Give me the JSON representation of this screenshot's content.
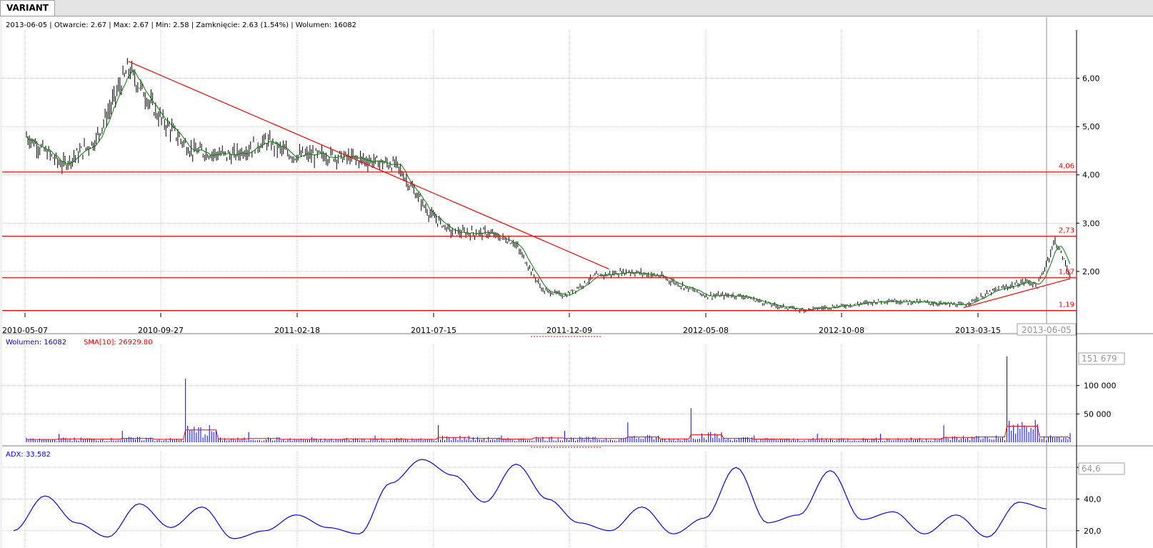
{
  "tab": {
    "label": "VARIANT"
  },
  "info_line": "2013-06-05 | Otwarcie: 2.67 | Max: 2.67 | Min: 2.58 | Zamknięcie: 2.63 (1.54%)  | Wolumen: 16082",
  "volume_info": {
    "volume": "Wolumen: 16082",
    "sma": "SMA[10]: 26929.80",
    "peak": "151 679"
  },
  "adx_info": {
    "label": "ADX: 33.582",
    "peak": "64,6"
  },
  "colors": {
    "price_bars": "#000000",
    "ma_line": "#008000",
    "trend_lines": "#ff0000",
    "volume_bars": "#0000ff",
    "volume_sma": "#ff0000",
    "adx_line": "#0000ff",
    "grid": "#c8c8c8"
  },
  "chart_data": [
    {
      "type": "ohlc",
      "title": "",
      "x_tick_labels": [
        "2010-05-07",
        "2010-09-27",
        "2011-02-18",
        "2011-07-15",
        "2011-12-09",
        "2012-05-08",
        "2012-10-08",
        "2013-03-15",
        "2013-06-05"
      ],
      "y_tick_labels": [
        "2,00",
        "3,00",
        "4,00",
        "5,00",
        "6,00"
      ],
      "ylim": [
        1.17,
        7.0
      ],
      "x": [
        "2010-05-07",
        "2010-06-15",
        "2010-07-20",
        "2010-08-15",
        "2010-08-25",
        "2010-09-27",
        "2010-11-01",
        "2010-12-15",
        "2011-01-20",
        "2011-02-18",
        "2011-04-01",
        "2011-05-10",
        "2011-06-10",
        "2011-07-15",
        "2011-08-10",
        "2011-09-15",
        "2011-10-15",
        "2011-11-15",
        "2011-12-09",
        "2012-01-10",
        "2012-02-15",
        "2012-03-20",
        "2012-05-08",
        "2012-06-15",
        "2012-07-20",
        "2012-08-20",
        "2012-10-08",
        "2012-11-20",
        "2013-01-05",
        "2013-02-10",
        "2013-03-15",
        "2013-04-20",
        "2013-05-01",
        "2013-05-20",
        "2013-06-05"
      ],
      "close": [
        4.8,
        4.2,
        4.7,
        5.8,
        6.2,
        5.2,
        4.5,
        4.4,
        4.7,
        4.4,
        4.4,
        4.3,
        4.2,
        3.2,
        2.8,
        2.8,
        2.6,
        1.6,
        1.5,
        1.9,
        2.0,
        1.9,
        1.5,
        1.5,
        1.3,
        1.2,
        1.3,
        1.4,
        1.35,
        1.3,
        1.6,
        1.8,
        1.7,
        2.65,
        1.93
      ],
      "horizontal_lines": [
        {
          "value": 4.06,
          "label": "4,06"
        },
        {
          "value": 2.73,
          "label": "2,73"
        },
        {
          "value": 1.87,
          "label": "1,87"
        },
        {
          "value": 1.19,
          "label": "1,19"
        }
      ],
      "trend_lines": [
        {
          "from": [
            "2010-08-25",
            6.35
          ],
          "to": [
            "2012-01-25",
            2.05
          ]
        },
        {
          "from": [
            "2013-02-10",
            1.25
          ],
          "to": [
            "2013-06-05",
            1.85
          ]
        }
      ]
    },
    {
      "type": "bar",
      "title": "",
      "series": [
        {
          "name": "Wolumen",
          "values": [
            8000,
            15000,
            12000,
            20000,
            10000,
            112000,
            15000,
            18000,
            10000,
            9000,
            14000,
            12000,
            10000,
            30000,
            20000,
            12000,
            25000,
            20000,
            18000,
            35000,
            15000,
            60000,
            20000,
            12000,
            10000,
            15000,
            12000,
            15000,
            15000,
            30000,
            35000,
            151679,
            35000,
            16082
          ]
        }
      ],
      "sma_label": "SMA[10]",
      "y_tick_labels": [
        "50 000",
        "100 000"
      ],
      "ylim": [
        0,
        160000
      ]
    },
    {
      "type": "line",
      "title": "",
      "series": [
        {
          "name": "ADX",
          "values": [
            20,
            42,
            25,
            16,
            37,
            22,
            35,
            15,
            20,
            30,
            22,
            18,
            50,
            65,
            55,
            38,
            62,
            40,
            25,
            20,
            35,
            18,
            28,
            60,
            25,
            30,
            58,
            27,
            32,
            18,
            30,
            16,
            38,
            33.6
          ]
        }
      ],
      "y_tick_labels": [
        "20,0",
        "40,0",
        "60,0"
      ],
      "ylim": [
        10,
        70
      ]
    }
  ]
}
